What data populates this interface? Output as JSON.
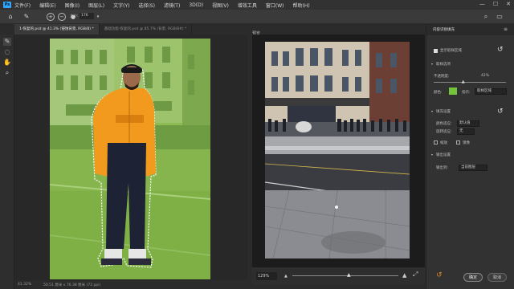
{
  "app": {
    "logo": "Ps"
  },
  "menu": [
    "文件(F)",
    "编辑(E)",
    "图像(I)",
    "图层(L)",
    "文字(Y)",
    "选择(S)",
    "滤镜(T)",
    "3D(D)",
    "视图(V)",
    "增效工具",
    "窗口(W)",
    "帮助(H)"
  ],
  "window_controls": {
    "minimize": "—",
    "maximize": "☐",
    "close": "✕"
  },
  "options": {
    "size_label": "大小:",
    "size_value": "176"
  },
  "tabs": [
    {
      "label": "1-恢复的.psd @ 41.3% (侵蚀背景, RGB/8) *"
    },
    {
      "label": "基础功能-恢复的.psd @ 85.7% (背景, RGB/8#) *"
    }
  ],
  "status": {
    "zoom": "41.32%",
    "info": "50.51 厘米 x 76.38 厘米 (72 ppi)"
  },
  "preview": {
    "title": "预览",
    "zoom": "129%"
  },
  "panel": {
    "title": "内容识别填充",
    "show_sampling": "显示取样区域",
    "sampling_section": "取样选项",
    "opacity_label": "不透明度:",
    "opacity_value": "42%",
    "opacity_level": 0.42,
    "color_label": "颜色:",
    "indicates_label": "指示:",
    "indicates_value": "取样区域",
    "sampling_color": "#75c23b",
    "fill_section": "填充设置",
    "color_adapt_label": "颜色适应:",
    "color_adapt_value": "默认值",
    "rotate_adapt_label": "旋转适应:",
    "rotate_adapt_value": "无",
    "scale_label": "缩放",
    "mirror_label": "镜像",
    "output_section": "输出设置",
    "output_label": "输出到:",
    "output_value": "当前图层",
    "ok": "确定",
    "cancel": "取消"
  }
}
